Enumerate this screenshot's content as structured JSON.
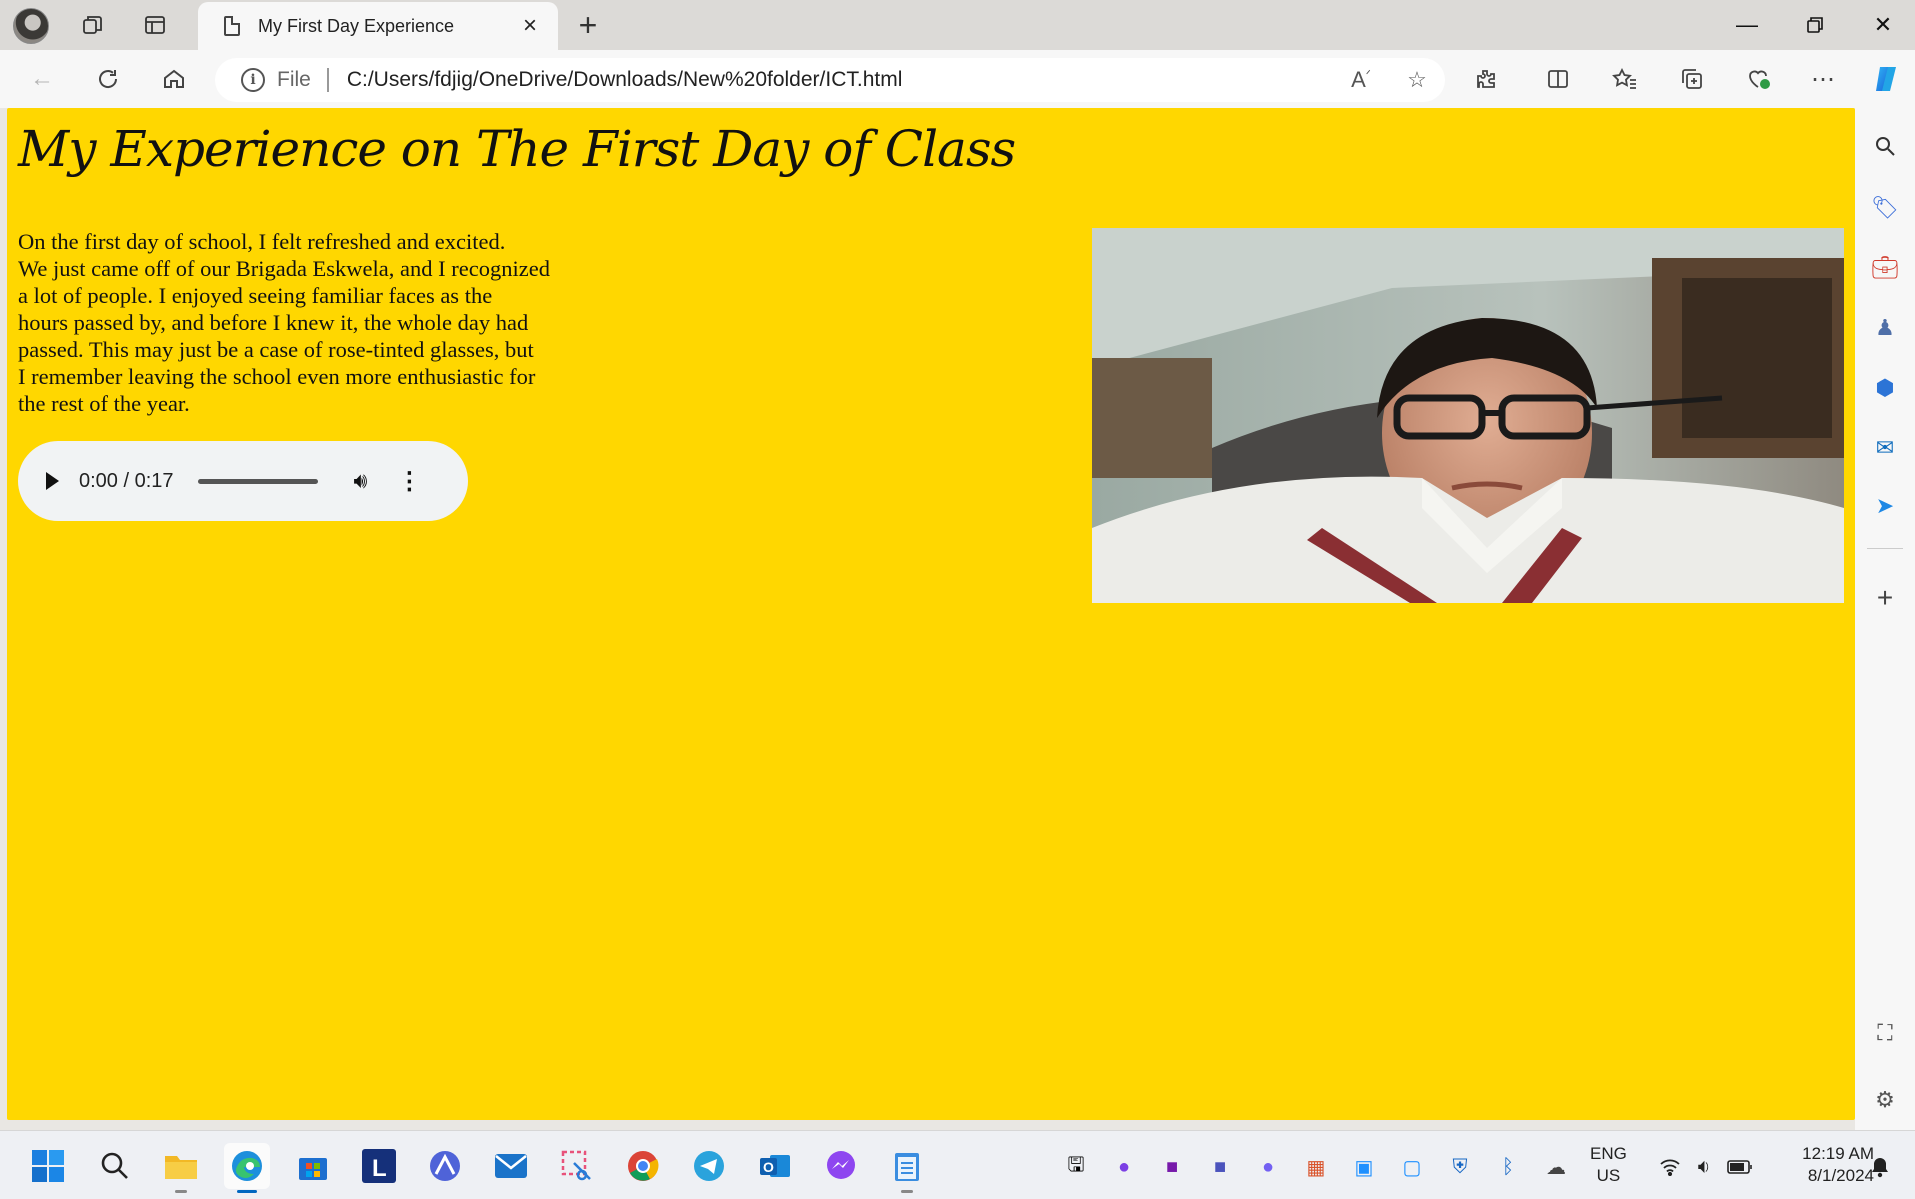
{
  "browser": {
    "tab_title": "My First Day Experience",
    "address_scheme": "File",
    "address_url": "C:/Users/fdjig/OneDrive/Downloads/New%20folder/ICT.html"
  },
  "page": {
    "heading": "My Experience on The First Day of Class",
    "story_lines": [
      "On the first day of school, I felt refreshed and excited.",
      "We just came off of our Brigada Eskwela, and I recognized",
      "a lot of people. I enjoyed seeing familiar faces as the",
      "hours passed by, and before I knew it, the whole day had",
      "passed. This may just be a case of rose-tinted glasses, but",
      "I remember leaving the school even more enthusiastic for",
      "the rest of the year."
    ],
    "background_color": "#ffd700",
    "audio": {
      "current_time": "0:00",
      "duration": "0:17",
      "time_display": "0:00 / 0:17"
    }
  },
  "taskbar": {
    "lang_line1": "ENG",
    "lang_line2": "US",
    "time": "12:19 AM",
    "date": "8/1/2024"
  }
}
